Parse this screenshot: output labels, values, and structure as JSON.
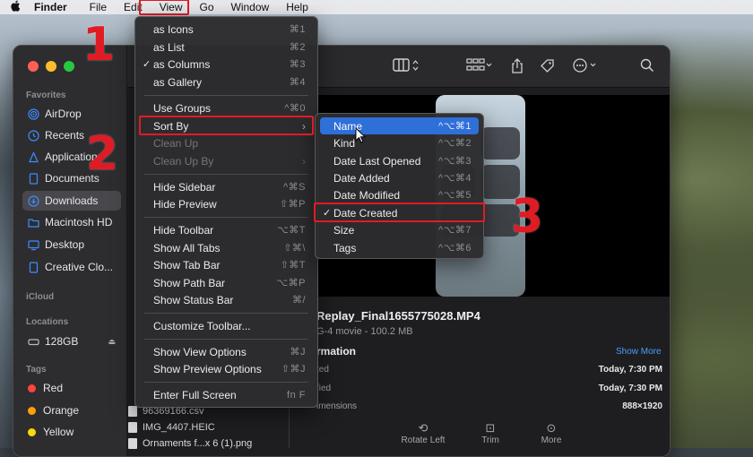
{
  "menubar": {
    "app": "Finder",
    "items": [
      "File",
      "Edit",
      "View",
      "Go",
      "Window",
      "Help"
    ]
  },
  "sidebar": {
    "favorites_header": "Favorites",
    "favorites": [
      {
        "label": "AirDrop",
        "icon": "airdrop-icon"
      },
      {
        "label": "Recents",
        "icon": "clock-icon"
      },
      {
        "label": "Applications",
        "icon": "applications-icon"
      },
      {
        "label": "Documents",
        "icon": "document-icon"
      },
      {
        "label": "Downloads",
        "icon": "download-icon",
        "active": true
      },
      {
        "label": "Macintosh HD",
        "icon": "folder-icon"
      },
      {
        "label": "Desktop",
        "icon": "desktop-icon"
      },
      {
        "label": "Creative Clo...",
        "icon": "document-icon"
      }
    ],
    "icloud_header": "iCloud",
    "locations_header": "Locations",
    "locations": [
      {
        "label": "128GB",
        "icon": "drive-icon"
      }
    ],
    "tags_header": "Tags",
    "tags": [
      {
        "label": "Red",
        "color": "#ff453a"
      },
      {
        "label": "Orange",
        "color": "#ff9f0a"
      },
      {
        "label": "Yellow",
        "color": "#ffd60a"
      }
    ]
  },
  "view_menu": {
    "items": [
      {
        "label": "as Icons",
        "shortcut": "⌘1"
      },
      {
        "label": "as List",
        "shortcut": "⌘2"
      },
      {
        "label": "as Columns",
        "shortcut": "⌘3",
        "checked": true
      },
      {
        "label": "as Gallery",
        "shortcut": "⌘4"
      },
      {
        "label": "Use Groups",
        "shortcut": "^⌘0"
      },
      {
        "label": "Sort By",
        "submenu": true
      },
      {
        "label": "Clean Up",
        "disabled": true
      },
      {
        "label": "Clean Up By",
        "disabled": true,
        "submenu": true
      },
      {
        "label": "Hide Sidebar",
        "shortcut": "^⌘S"
      },
      {
        "label": "Hide Preview",
        "shortcut": "⇧⌘P"
      },
      {
        "label": "Hide Toolbar",
        "shortcut": "⌥⌘T"
      },
      {
        "label": "Show All Tabs",
        "shortcut": "⇧⌘\\"
      },
      {
        "label": "Show Tab Bar",
        "shortcut": "⇧⌘T"
      },
      {
        "label": "Show Path Bar",
        "shortcut": "⌥⌘P"
      },
      {
        "label": "Show Status Bar",
        "shortcut": "⌘/"
      },
      {
        "label": "Customize Toolbar..."
      },
      {
        "label": "Show View Options",
        "shortcut": "⌘J"
      },
      {
        "label": "Show Preview Options",
        "shortcut": "⇧⌘J"
      },
      {
        "label": "Enter Full Screen",
        "shortcut": "fn F"
      }
    ]
  },
  "sort_menu": {
    "items": [
      {
        "label": "Name",
        "shortcut": "^⌥⌘1",
        "highlighted": true
      },
      {
        "label": "Kind",
        "shortcut": "^⌥⌘2"
      },
      {
        "label": "Date Last Opened",
        "shortcut": "^⌥⌘3"
      },
      {
        "label": "Date Added",
        "shortcut": "^⌥⌘4"
      },
      {
        "label": "Date Modified",
        "shortcut": "^⌥⌘5"
      },
      {
        "label": "Date Created",
        "checked": true
      },
      {
        "label": "Size",
        "shortcut": "^⌥⌘7"
      },
      {
        "label": "Tags",
        "shortcut": "^⌥⌘6"
      }
    ]
  },
  "steps": [
    "1",
    "2",
    "3"
  ],
  "preview": {
    "filename": "Replay_Final1655775028.MP4",
    "subtitle": "G-4 movie - 100.2 MB",
    "info_header": "rmation",
    "show_more": "Show More",
    "rows": [
      {
        "label": "ted",
        "value": "Today, 7:30 PM"
      },
      {
        "label": "fied",
        "value": "Today, 7:30 PM"
      },
      {
        "label": "imensions",
        "value": "888×1920"
      }
    ],
    "actions": [
      "Rotate Left",
      "Trim",
      "More"
    ]
  },
  "files": [
    "96369166.csv",
    "IMG_4407.HEIC",
    "Ornaments f...x 6 (1).png"
  ]
}
